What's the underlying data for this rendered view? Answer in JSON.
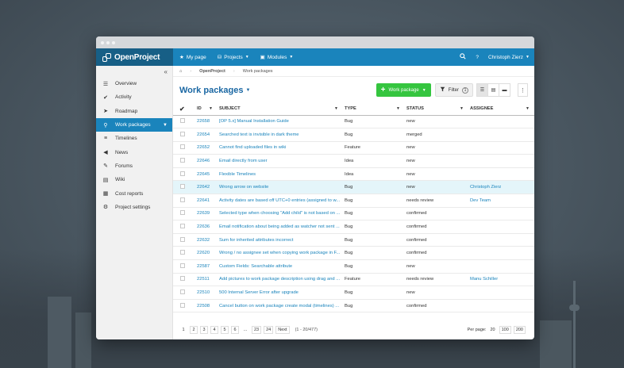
{
  "app": {
    "name": "OpenProject"
  },
  "topnav": {
    "my_page": "My page",
    "projects": "Projects",
    "modules": "Modules",
    "help": "?",
    "user": "Christoph Zierz"
  },
  "sidebar": {
    "items": [
      {
        "label": "Overview",
        "icon": "overview-icon"
      },
      {
        "label": "Activity",
        "icon": "checkmark-icon"
      },
      {
        "label": "Roadmap",
        "icon": "roadmap-icon"
      },
      {
        "label": "Work packages",
        "icon": "work-packages-icon",
        "active": true
      },
      {
        "label": "Timelines",
        "icon": "timelines-icon"
      },
      {
        "label": "News",
        "icon": "megaphone-icon"
      },
      {
        "label": "Forums",
        "icon": "forums-icon"
      },
      {
        "label": "Wiki",
        "icon": "book-icon"
      },
      {
        "label": "Cost reports",
        "icon": "cost-reports-icon"
      },
      {
        "label": "Project settings",
        "icon": "gear-icon"
      }
    ]
  },
  "breadcrumb": {
    "project": "OpenProject",
    "current": "Work packages"
  },
  "toolbar": {
    "title": "Work packages",
    "add_label": "Work package",
    "filter_label": "Filter",
    "filter_count": "1"
  },
  "table": {
    "headers": {
      "id": "ID",
      "subject": "SUBJECT",
      "type": "TYPE",
      "status": "STATUS",
      "assignee": "ASSIGNEE"
    },
    "rows": [
      {
        "id": "22658",
        "subject": "[OP 5.x] Manual Installation Guide",
        "type": "Bug",
        "status": "new",
        "assignee": ""
      },
      {
        "id": "22654",
        "subject": "Searched text is invisible in dark theme",
        "type": "Bug",
        "status": "merged",
        "assignee": ""
      },
      {
        "id": "22652",
        "subject": "Cannot find uploaded files in wiki",
        "type": "Feature",
        "status": "new",
        "assignee": ""
      },
      {
        "id": "22646",
        "subject": "Email directly from user",
        "type": "Idea",
        "status": "new",
        "assignee": ""
      },
      {
        "id": "22645",
        "subject": "Flexible Timelines",
        "type": "Idea",
        "status": "new",
        "assignee": ""
      },
      {
        "id": "22642",
        "subject": "Wrong arrow on website",
        "type": "Bug",
        "status": "new",
        "assignee": "Christoph Zierz"
      },
      {
        "id": "22641",
        "subject": "Activity dates are based off UTC+0 entries (assigned to w...",
        "type": "Bug",
        "status": "needs review",
        "assignee": "Dev Team"
      },
      {
        "id": "22639",
        "subject": "Selected type when choosing \"Add child\" is not based on ...",
        "type": "Bug",
        "status": "confirmed",
        "assignee": ""
      },
      {
        "id": "22636",
        "subject": "Email notification about being added as watcher not sent ...",
        "type": "Bug",
        "status": "confirmed",
        "assignee": ""
      },
      {
        "id": "22632",
        "subject": "Sum for inherited attributes incorrect",
        "type": "Bug",
        "status": "confirmed",
        "assignee": ""
      },
      {
        "id": "22620",
        "subject": "Wrong / no assignee set when copying work package in F...",
        "type": "Bug",
        "status": "confirmed",
        "assignee": ""
      },
      {
        "id": "22587",
        "subject": "Custom Fields: Searchable attribute",
        "type": "Bug",
        "status": "new",
        "assignee": ""
      },
      {
        "id": "22511",
        "subject": "Add pictures to work package description using drag and ...",
        "type": "Feature",
        "status": "needs review",
        "assignee": "Manu Schiller"
      },
      {
        "id": "22510",
        "subject": "500 Internal Server Error after upgrade",
        "type": "Bug",
        "status": "new",
        "assignee": ""
      },
      {
        "id": "22508",
        "subject": "Cancel button on work package create modal (timelines) ...",
        "type": "Bug",
        "status": "confirmed",
        "assignee": ""
      }
    ],
    "highlight_index": 5
  },
  "pagination": {
    "pages": [
      "1",
      "2",
      "3",
      "4",
      "5",
      "6",
      "...",
      "23",
      "24"
    ],
    "next": "Next",
    "info": "(1 - 20/477)",
    "per_page_label": "Per page:",
    "per_page_options": [
      "20",
      "100",
      "200"
    ]
  }
}
